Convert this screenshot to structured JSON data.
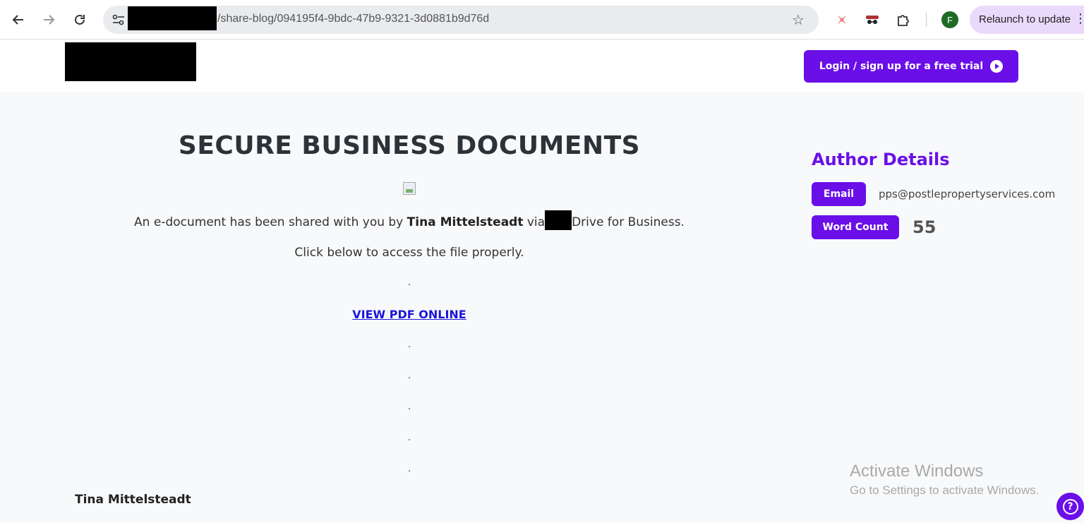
{
  "browser": {
    "url_text": "/share-blog/094195f4-9bdc-47b9-9321-3d0881b9d76d",
    "profile_initial": "F",
    "relaunch_label": "Relaunch to update",
    "icons": [
      "back-arrow-icon",
      "forward-arrow-icon",
      "reload-icon",
      "site-settings-icon",
      "bookmark-star-icon",
      "extension-icon",
      "incognito-icon",
      "puzzle-icon",
      "kebab-menu-icon"
    ]
  },
  "header": {
    "login_label": "Login / sign up for a free trial"
  },
  "main": {
    "title": "SECURE BUSINESS DOCUMENTS",
    "share_prefix": "An e-document has been shared with you by ",
    "sharer_name": "Tina Mittelsteadt",
    "share_via": " via",
    "share_suffix": "Drive for Business.",
    "click_instruction": "Click below to access the file properly.",
    "dot": ".",
    "view_link": "VIEW PDF ONLINE",
    "footer_name": "Tina Mittelsteadt"
  },
  "sidebar": {
    "title": "Author Details",
    "email_label": "Email",
    "email_value": "pps@postlepropertyservices.com",
    "word_count_label": "Word Count",
    "word_count_value": "55"
  },
  "watermark": {
    "line1": "Activate Windows",
    "line2": "Go to Settings to activate Windows."
  },
  "colors": {
    "accent": "#6a0fe8",
    "link": "#1a16d6",
    "title": "#2c3338"
  }
}
